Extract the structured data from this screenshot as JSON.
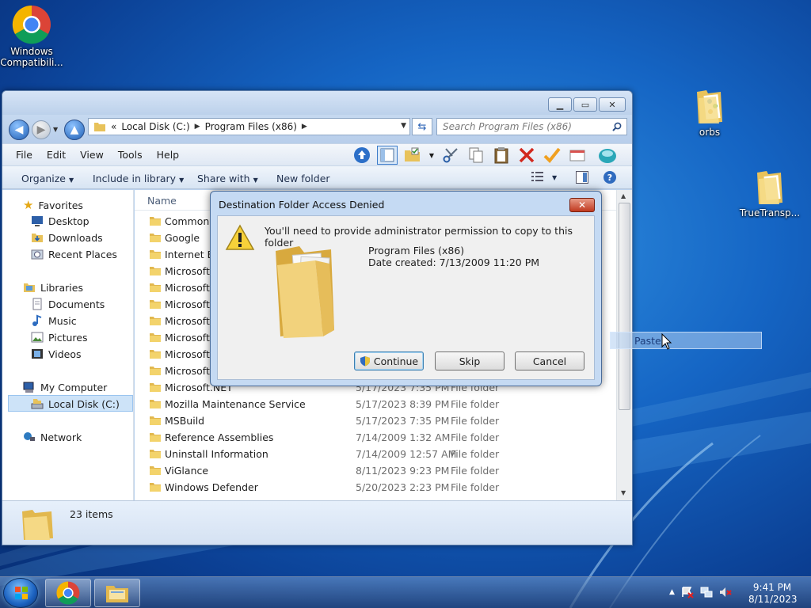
{
  "desktop": {
    "icons": [
      {
        "label": "Windows Compatibili..."
      },
      {
        "label": "orbs"
      },
      {
        "label": "TrueTransp..."
      }
    ]
  },
  "explorer": {
    "address": {
      "crumbs": [
        "«",
        "Local Disk (C:)",
        "Program Files (x86)"
      ]
    },
    "search_placeholder": "Search Program Files (x86)",
    "menu": [
      "File",
      "Edit",
      "View",
      "Tools",
      "Help"
    ],
    "commands": {
      "organize": "Organize",
      "include": "Include in library",
      "share": "Share with",
      "new_folder": "New folder"
    },
    "nav": {
      "favorites": "Favorites",
      "desktop": "Desktop",
      "downloads": "Downloads",
      "recent": "Recent Places",
      "libraries": "Libraries",
      "documents": "Documents",
      "music": "Music",
      "pictures": "Pictures",
      "videos": "Videos",
      "computer": "My Computer",
      "local_disk": "Local Disk (C:)",
      "network": "Network"
    },
    "columns": {
      "name": "Name"
    },
    "files": [
      {
        "name": "Common F",
        "date": "",
        "type": ""
      },
      {
        "name": "Google",
        "date": "",
        "type": ""
      },
      {
        "name": "Internet Exp",
        "date": "",
        "type": ""
      },
      {
        "name": "Microsoft F",
        "date": "",
        "type": ""
      },
      {
        "name": "Microsoft S",
        "date": "",
        "type": ""
      },
      {
        "name": "Microsoft S",
        "date": "",
        "type": ""
      },
      {
        "name": "Microsoft S",
        "date": "",
        "type": ""
      },
      {
        "name": "Microsoft S",
        "date": "",
        "type": ""
      },
      {
        "name": "Microsoft V",
        "date": "",
        "type": ""
      },
      {
        "name": "Microsoft V",
        "date": "",
        "type": ""
      },
      {
        "name": "Microsoft.NET",
        "date": "5/17/2023 7:35 PM",
        "type": "File folder"
      },
      {
        "name": "Mozilla Maintenance Service",
        "date": "5/17/2023 8:39 PM",
        "type": "File folder"
      },
      {
        "name": "MSBuild",
        "date": "5/17/2023 7:35 PM",
        "type": "File folder"
      },
      {
        "name": "Reference Assemblies",
        "date": "7/14/2009 1:32 AM",
        "type": "File folder"
      },
      {
        "name": "Uninstall Information",
        "date": "7/14/2009 12:57 AM",
        "type": "File folder"
      },
      {
        "name": "ViGlance",
        "date": "8/11/2023 9:23 PM",
        "type": "File folder"
      },
      {
        "name": "Windows Defender",
        "date": "5/20/2023 2:23 PM",
        "type": "File folder"
      }
    ],
    "status": {
      "count": "23 items"
    }
  },
  "dialog": {
    "title": "Destination Folder Access Denied",
    "message": "You'll need to provide administrator permission to copy to this folder",
    "folder_name": "Program Files (x86)",
    "date_created": "Date created: 7/13/2009 11:20 PM",
    "buttons": {
      "continue": "Continue",
      "skip": "Skip",
      "cancel": "Cancel"
    }
  },
  "drag_tip": {
    "label": "Paste"
  },
  "taskbar": {
    "time": "9:41 PM",
    "date": "8/11/2023"
  },
  "colors": {
    "desktop_blue": "#1565c4",
    "selection": "#cde3f8",
    "folder_yellow": "#f3d36b"
  }
}
